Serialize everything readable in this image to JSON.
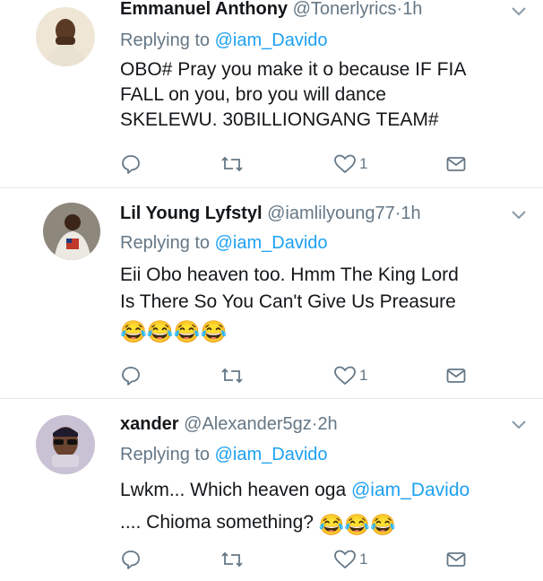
{
  "tweets": [
    {
      "name": "Emmanuel Anthony",
      "handle": "@Tonerlyrics",
      "separator": "·",
      "time": "1h",
      "reply_prefix": "Replying to",
      "reply_to": "@iam_Davido",
      "lines": [
        "OBO# Pray you make it o because  IF FIA",
        "FALL on you, bro you will dance",
        "SKELEWU. 30BILLIONGANG TEAM#"
      ],
      "like_count": "1",
      "icons": [
        "reply-icon",
        "retweet-icon",
        "like-icon",
        "dm-icon",
        "chevron-down-icon"
      ]
    },
    {
      "name": "Lil Young Lyfstyl",
      "handle": "@iamlilyoung77",
      "separator": "·",
      "time": "1h",
      "reply_prefix": "Replying to",
      "reply_to": "@iam_Davido",
      "lines": [
        "Eii Obo heaven too. Hmm The King Lord",
        "Is There So You Can't Give Us Preasure"
      ],
      "emoji": "😂😂😂😂",
      "like_count": "1",
      "icons": [
        "reply-icon",
        "retweet-icon",
        "like-icon",
        "dm-icon",
        "chevron-down-icon"
      ]
    },
    {
      "name": "xander",
      "handle": "@Alexander5gz",
      "separator": "·",
      "time": "2h",
      "reply_prefix": "Replying to",
      "reply_to": "@iam_Davido",
      "line1_text": "Lwkm...  Which heaven oga ",
      "line1_mention": "@iam_Davido",
      "line2_text": "....  Chioma something? ",
      "line2_emoji": "😂😂😂",
      "like_count": "1",
      "icons": [
        "reply-icon",
        "retweet-icon",
        "like-icon",
        "dm-icon",
        "chevron-down-icon"
      ]
    }
  ],
  "colors": {
    "text": "#14171a",
    "muted": "#657786",
    "link": "#1da1f2",
    "divider": "#e1e8ed"
  }
}
